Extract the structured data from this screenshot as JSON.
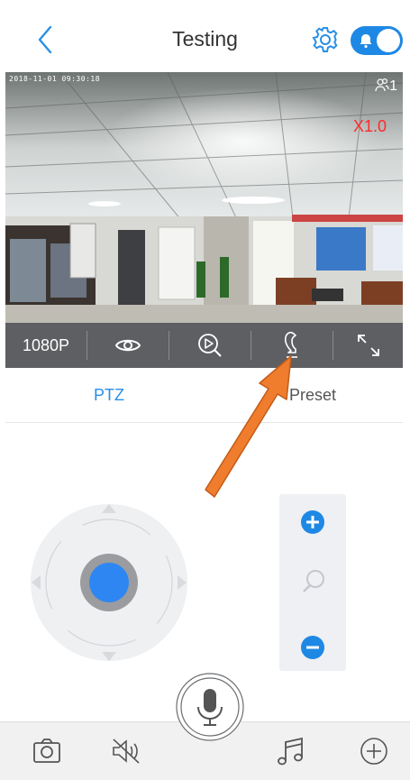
{
  "header": {
    "title": "Testing",
    "back_icon": "chevron-left-icon",
    "settings_icon": "gear-icon",
    "alarm_toggle_icon": "bell-icon",
    "accent": "#1e88e5"
  },
  "video": {
    "timestamp": "2018-11-01 09:30:18",
    "viewer_count": "1",
    "zoom_level": "X1.0"
  },
  "control_bar": {
    "resolution": "1080P",
    "items": [
      "eye-icon",
      "playback-search-icon",
      "intercom-handset-icon",
      "fullscreen-icon"
    ]
  },
  "tabs": [
    {
      "label": "PTZ",
      "active": true
    },
    {
      "label": "Preset",
      "active": false
    }
  ],
  "zoom_panel": {
    "items": [
      "zoom-in-icon",
      "magnifier-icon",
      "zoom-out-icon"
    ]
  },
  "bottom_bar": {
    "items": [
      "camera-icon",
      "mute-icon",
      "microphone-icon",
      "music-icon",
      "add-icon"
    ]
  },
  "annotation": {
    "arrow_color": "#ef7d2d"
  }
}
